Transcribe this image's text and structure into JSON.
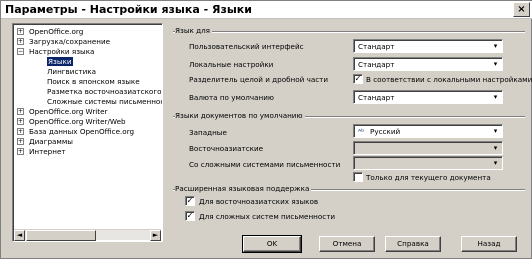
{
  "window": {
    "title": "Параметры - Настройки языка - Языки",
    "close_glyph": "×"
  },
  "tree": {
    "items": [
      {
        "label": "OpenOffice.org",
        "indent": 0,
        "expander": "+"
      },
      {
        "label": "Загрузка/сохранение",
        "indent": 0,
        "expander": "+"
      },
      {
        "label": "Настройки языка",
        "indent": 0,
        "expander": "−"
      },
      {
        "label": "Языки",
        "indent": 1,
        "selected": true
      },
      {
        "label": "Лингвистика",
        "indent": 1
      },
      {
        "label": "Поиск в японском языке",
        "indent": 1
      },
      {
        "label": "Разметка восточноазиатского текста",
        "indent": 1
      },
      {
        "label": "Сложные системы письменности",
        "indent": 1
      },
      {
        "label": "OpenOffice.org Writer",
        "indent": 0,
        "expander": "+"
      },
      {
        "label": "OpenOffice.org Writer/Web",
        "indent": 0,
        "expander": "+"
      },
      {
        "label": "База данных OpenOffice.org",
        "indent": 0,
        "expander": "+"
      },
      {
        "label": "Диаграммы",
        "indent": 0,
        "expander": "+"
      },
      {
        "label": "Интернет",
        "indent": 0,
        "expander": "+"
      }
    ],
    "scroll_left": "◄",
    "scroll_right": "►"
  },
  "language_of": {
    "group_title": "Язык для",
    "ui_label": "Пользовательский интерфейс",
    "ui_value": "Стандарт",
    "locale_label": "Локальные настройки",
    "locale_value": "Стандарт",
    "decimal_label": "Разделитель целой и дробной части",
    "decimal_checked": true,
    "decimal_value": "В соответствии с локальными настройками",
    "currency_label": "Валюта по умолчанию",
    "currency_value": "Стандарт"
  },
  "default_languages": {
    "group_title": "Языки документов по умолчанию",
    "western_label": "Западные",
    "western_value": "Русский",
    "western_icon": "spellcheck-icon",
    "asian_label": "Восточноазиатские",
    "asian_value": "",
    "ctl_label": "Со сложными системами письменности",
    "ctl_value": "",
    "current_doc_label": "Только для текущего документа",
    "current_doc_checked": false
  },
  "enhanced": {
    "group_title": "Расширенная языковая поддержка",
    "asian_label": "Для восточноазиатских языков",
    "asian_checked": true,
    "ctl_label": "Для сложных систем письменности",
    "ctl_checked": true
  },
  "buttons": {
    "ok": "OK",
    "cancel": "Отмена",
    "help": "Справка",
    "back": "Назад"
  },
  "colors": {
    "selection": "#0a246a",
    "face": "#d4d0c8"
  }
}
